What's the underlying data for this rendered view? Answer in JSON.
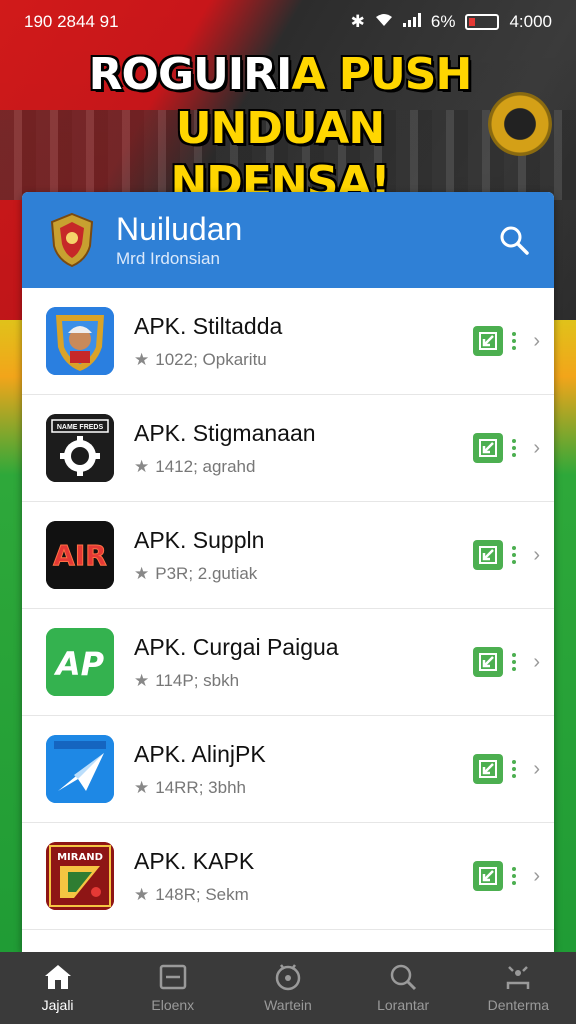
{
  "status_bar": {
    "left_text": "190 2844 91",
    "battery": "6%",
    "time": "4:000"
  },
  "headline": {
    "line1_white": "ROGUIRI",
    "line1_yellow": "A PUSH",
    "line2": "UNDUAN NDENSA!"
  },
  "header": {
    "title": "Nuiludan",
    "subtitle": "Mrd Irdonsian"
  },
  "apps": [
    {
      "title": "APK. Stiltadda",
      "meta": "1022; Opkaritu",
      "icon": "shield-avatar-icon"
    },
    {
      "title": "APK. Stigmanaan",
      "meta": "1412; agrahd",
      "icon": "gear-badge-icon"
    },
    {
      "title": "APK. Suppln",
      "meta": "P3R; 2.gutiak",
      "icon": "air-logo-icon"
    },
    {
      "title": "APK. Curgai Paigua",
      "meta": "114P; sbkh",
      "icon": "ap-logo-icon"
    },
    {
      "title": "APK. AlinjPK",
      "meta": "14RR; 3bhh",
      "icon": "paper-plane-icon"
    },
    {
      "title": "APK. KAPK",
      "meta": "148R; Sekm",
      "icon": "mirando-logo-icon"
    }
  ],
  "icon_labels": {
    "gear_badge": "NAME FREDS",
    "air": "AIR",
    "ap": "AP",
    "mirando": "MIRAND"
  },
  "nav": [
    {
      "label": "Jajali",
      "icon": "home-icon",
      "active": true
    },
    {
      "label": "Eloenx",
      "icon": "inbox-icon",
      "active": false
    },
    {
      "label": "Wartein",
      "icon": "compass-icon",
      "active": false
    },
    {
      "label": "Lorantar",
      "icon": "search-icon",
      "active": false
    },
    {
      "label": "Denterma",
      "icon": "profile-icon",
      "active": false
    }
  ],
  "colors": {
    "header_blue": "#2f80d6",
    "download_green": "#4caf50",
    "nav_bg": "#3a3a3a",
    "headline_yellow": "#ffd600"
  }
}
